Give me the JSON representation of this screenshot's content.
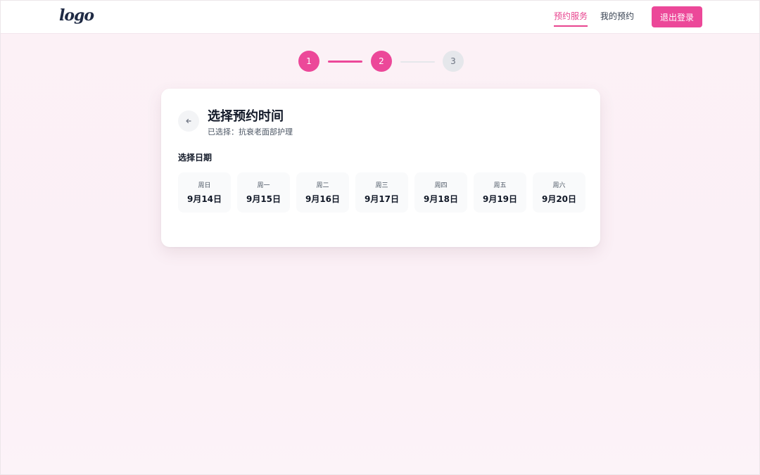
{
  "header": {
    "logo": "logo",
    "nav": [
      {
        "label": "预约服务",
        "active": true
      },
      {
        "label": "我的预约",
        "active": false
      }
    ],
    "logout_label": "退出登录"
  },
  "stepper": {
    "steps": [
      "1",
      "2",
      "3"
    ],
    "current": 2
  },
  "card": {
    "title": "选择预约时间",
    "subtitle": "已选择：抗衰老面部护理",
    "section_title": "选择日期",
    "dates": [
      {
        "weekday": "周日",
        "date": "9月14日"
      },
      {
        "weekday": "周一",
        "date": "9月15日"
      },
      {
        "weekday": "周二",
        "date": "9月16日"
      },
      {
        "weekday": "周三",
        "date": "9月17日"
      },
      {
        "weekday": "周四",
        "date": "9月18日"
      },
      {
        "weekday": "周五",
        "date": "9月19日"
      },
      {
        "weekday": "周六",
        "date": "9月20日"
      }
    ]
  },
  "colors": {
    "accent": "#ec4899",
    "inactive_step": "#e5e7eb",
    "background": "#fcf1f6"
  },
  "icons": {
    "back": "arrow-left-icon"
  }
}
